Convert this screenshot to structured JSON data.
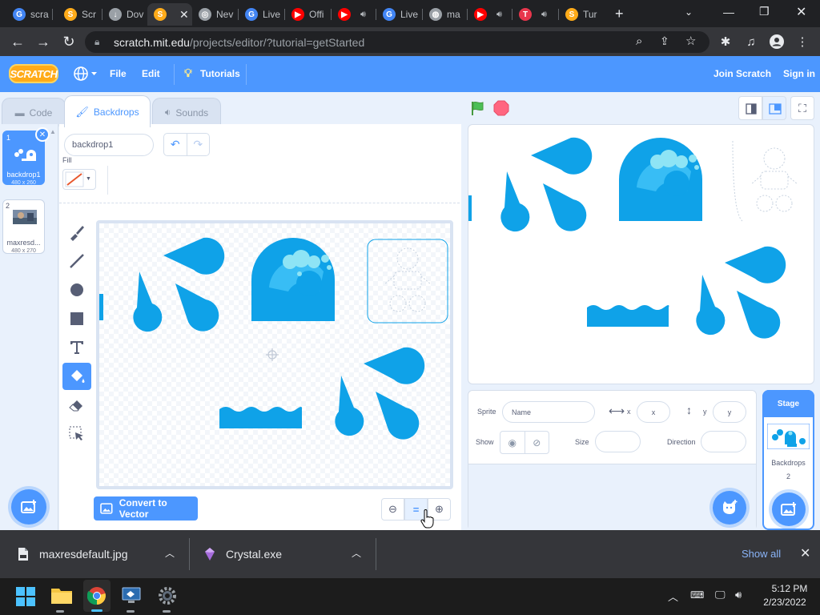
{
  "browser": {
    "tabs": [
      {
        "label": "scra",
        "icon": "google-icon",
        "color": "#4285f4"
      },
      {
        "label": "Scr",
        "icon": "scratch-icon",
        "color": "#ffab19"
      },
      {
        "label": "Dov",
        "icon": "download-icon",
        "color": "#9aa0a6"
      },
      {
        "label": "",
        "icon": "scratch-icon",
        "color": "#ffab19"
      },
      {
        "label": "Nev",
        "icon": "chrome-icon",
        "color": "#9aa0a6"
      },
      {
        "label": "Live",
        "icon": "google-icon",
        "color": "#4285f4"
      },
      {
        "label": "Offi",
        "icon": "youtube-icon",
        "color": "#ff0000"
      },
      {
        "label": "",
        "icon": "youtube-icon",
        "color": "#ff0000"
      },
      {
        "label": "Live",
        "icon": "google-icon",
        "color": "#4285f4"
      },
      {
        "label": "ma",
        "icon": "globe-icon",
        "color": "#9aa0a6"
      },
      {
        "label": "",
        "icon": "youtube-icon",
        "color": "#ff0000"
      },
      {
        "label": "",
        "icon": "tinkercad-icon",
        "color": "#e8364c"
      },
      {
        "label": "Tur",
        "icon": "scratch-icon",
        "color": "#ffab19"
      }
    ],
    "url_host": "scratch.mit.edu",
    "url_path": "/projects/editor/?tutorial=getStarted",
    "new_tab": "+"
  },
  "scratch": {
    "logo": "SCRATCH",
    "menu": {
      "file": "File",
      "edit": "Edit",
      "tutorials": "Tutorials",
      "join": "Join Scratch",
      "signin": "Sign in"
    },
    "tabs": {
      "code": "Code",
      "backdrops": "Backdrops",
      "sounds": "Sounds"
    },
    "backdrops": [
      {
        "num": "1",
        "name": "backdrop1",
        "size": "480 x 260"
      },
      {
        "num": "2",
        "name": "maxresd...",
        "size": "480 x 270"
      }
    ],
    "editor": {
      "costume_name": "backdrop1",
      "fill_label": "Fill",
      "convert_button": "Convert to Vector",
      "zoom_reset": "="
    },
    "sprite": {
      "sprite_label": "Sprite",
      "name_placeholder": "Name",
      "x_label": "x",
      "x_placeholder": "x",
      "y_label": "y",
      "y_placeholder": "y",
      "show_label": "Show",
      "size_label": "Size",
      "direction_label": "Direction"
    },
    "stage_panel": {
      "title": "Stage",
      "backdrops_label": "Backdrops",
      "backdrops_count": "2"
    },
    "colors": {
      "blue": "#4c97ff",
      "art": "#0fa2e8",
      "bubble": "#8ee4f5",
      "green": "#4cbf56",
      "red": "#ff6680"
    }
  },
  "downloads": {
    "items": [
      {
        "name": "maxresdefault.jpg"
      },
      {
        "name": "Crystal.exe"
      }
    ],
    "show_all": "Show all"
  },
  "taskbar": {
    "time": "5:12 PM",
    "date": "2/23/2022"
  }
}
